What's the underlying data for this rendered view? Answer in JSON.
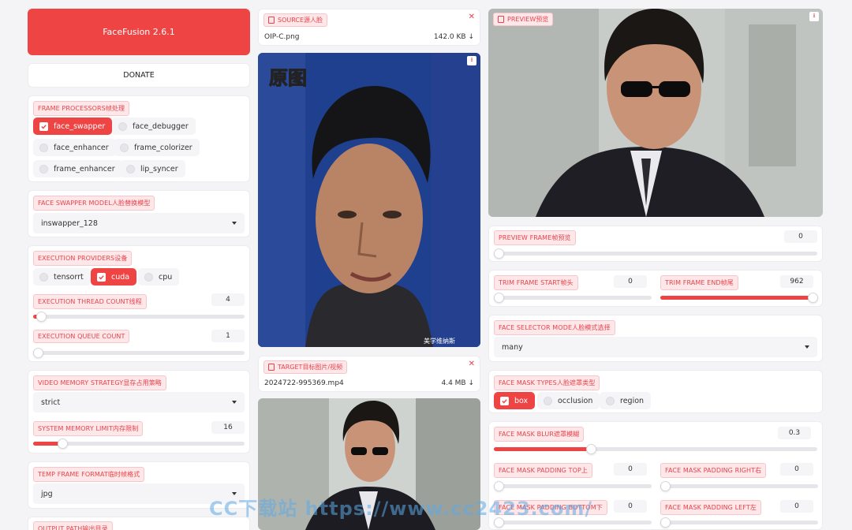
{
  "app": {
    "title_button": "FaceFusion 2.6.1",
    "donate_button": "DONATE"
  },
  "frame_processors": {
    "label": "FRAME PROCESSORS帧处理",
    "options": [
      {
        "label": "face_swapper",
        "checked": true
      },
      {
        "label": "face_debugger",
        "checked": false
      },
      {
        "label": "face_enhancer",
        "checked": false
      },
      {
        "label": "frame_colorizer",
        "checked": false
      },
      {
        "label": "frame_enhancer",
        "checked": false
      },
      {
        "label": "lip_syncer",
        "checked": false
      }
    ]
  },
  "face_swapper_model": {
    "label": "FACE SWAPPER MODEL人脸替换模型",
    "value": "inswapper_128"
  },
  "execution_providers": {
    "label": "EXECUTION PROVIDERS设备",
    "options": [
      {
        "label": "tensorrt",
        "checked": false
      },
      {
        "label": "cuda",
        "checked": true
      },
      {
        "label": "cpu",
        "checked": false
      }
    ],
    "thread_count_label": "EXECUTION THREAD COUNT线程",
    "thread_count_value": "4",
    "thread_count_fraction": 0.04,
    "queue_count_label": "EXECUTION QUEUE COUNT",
    "queue_count_value": "1",
    "queue_count_fraction": 0.0
  },
  "video_memory": {
    "strategy_label": "VIDEO MEMORY STRATEGY显存占用策略",
    "strategy_value": "strict",
    "limit_label": "SYSTEM MEMORY LIMIT内存限制",
    "limit_value": "16",
    "limit_fraction": 0.14
  },
  "temp_frame": {
    "label": "TEMP FRAME FORMAT临时帧格式",
    "value": "jpg"
  },
  "output_path": {
    "label": "OUTPUT PATH输出目录"
  },
  "source": {
    "label": "SOURCE源人脸",
    "file_name": "OIP-C.png",
    "file_size": "142.0 KB ↓",
    "image_caption": "原图",
    "image_watermark": "美学维纳斯"
  },
  "target": {
    "label": "TARGET目标图片/视频",
    "file_name": "2024722-995369.mp4",
    "file_size": "4.4 MB ↓"
  },
  "preview": {
    "label": "PREVIEW预览"
  },
  "preview_frame": {
    "label": "PREVIEW FRAME帧预览",
    "value": "0",
    "fraction": 0.0
  },
  "trim_frame": {
    "start_label": "TRIM FRAME START帧头",
    "start_value": "0",
    "start_fraction": 0.0,
    "end_label": "TRIM FRAME END帧尾",
    "end_value": "962",
    "end_fraction": 1.0
  },
  "face_selector_mode": {
    "label": "FACE SELECTOR MODE人脸模式选择",
    "value": "many"
  },
  "face_mask_types": {
    "label": "FACE MASK TYPES人脸遮罩类型",
    "options": [
      {
        "label": "box",
        "checked": true
      },
      {
        "label": "occlusion",
        "checked": false
      },
      {
        "label": "region",
        "checked": false
      }
    ]
  },
  "face_mask_blur": {
    "label": "FACE MASK BLUR遮罩模糊",
    "value": "0.3",
    "fraction": 0.3
  },
  "face_mask_padding": {
    "top_label": "FACE MASK PADDING TOP上",
    "top_value": "0",
    "right_label": "FACE MASK PADDING RIGHT右",
    "right_value": "0",
    "bottom_label": "FACE MASK PADDING BOTTOM下",
    "bottom_value": "0",
    "left_label": "FACE MASK PADDING LEFT左",
    "left_value": "0"
  },
  "site_watermark": "CC下载站 https://www.cc2423.com/",
  "colors": {
    "accent": "#ef4444",
    "tag_bg": "#fde7e8",
    "tag_text": "#e8434b"
  }
}
